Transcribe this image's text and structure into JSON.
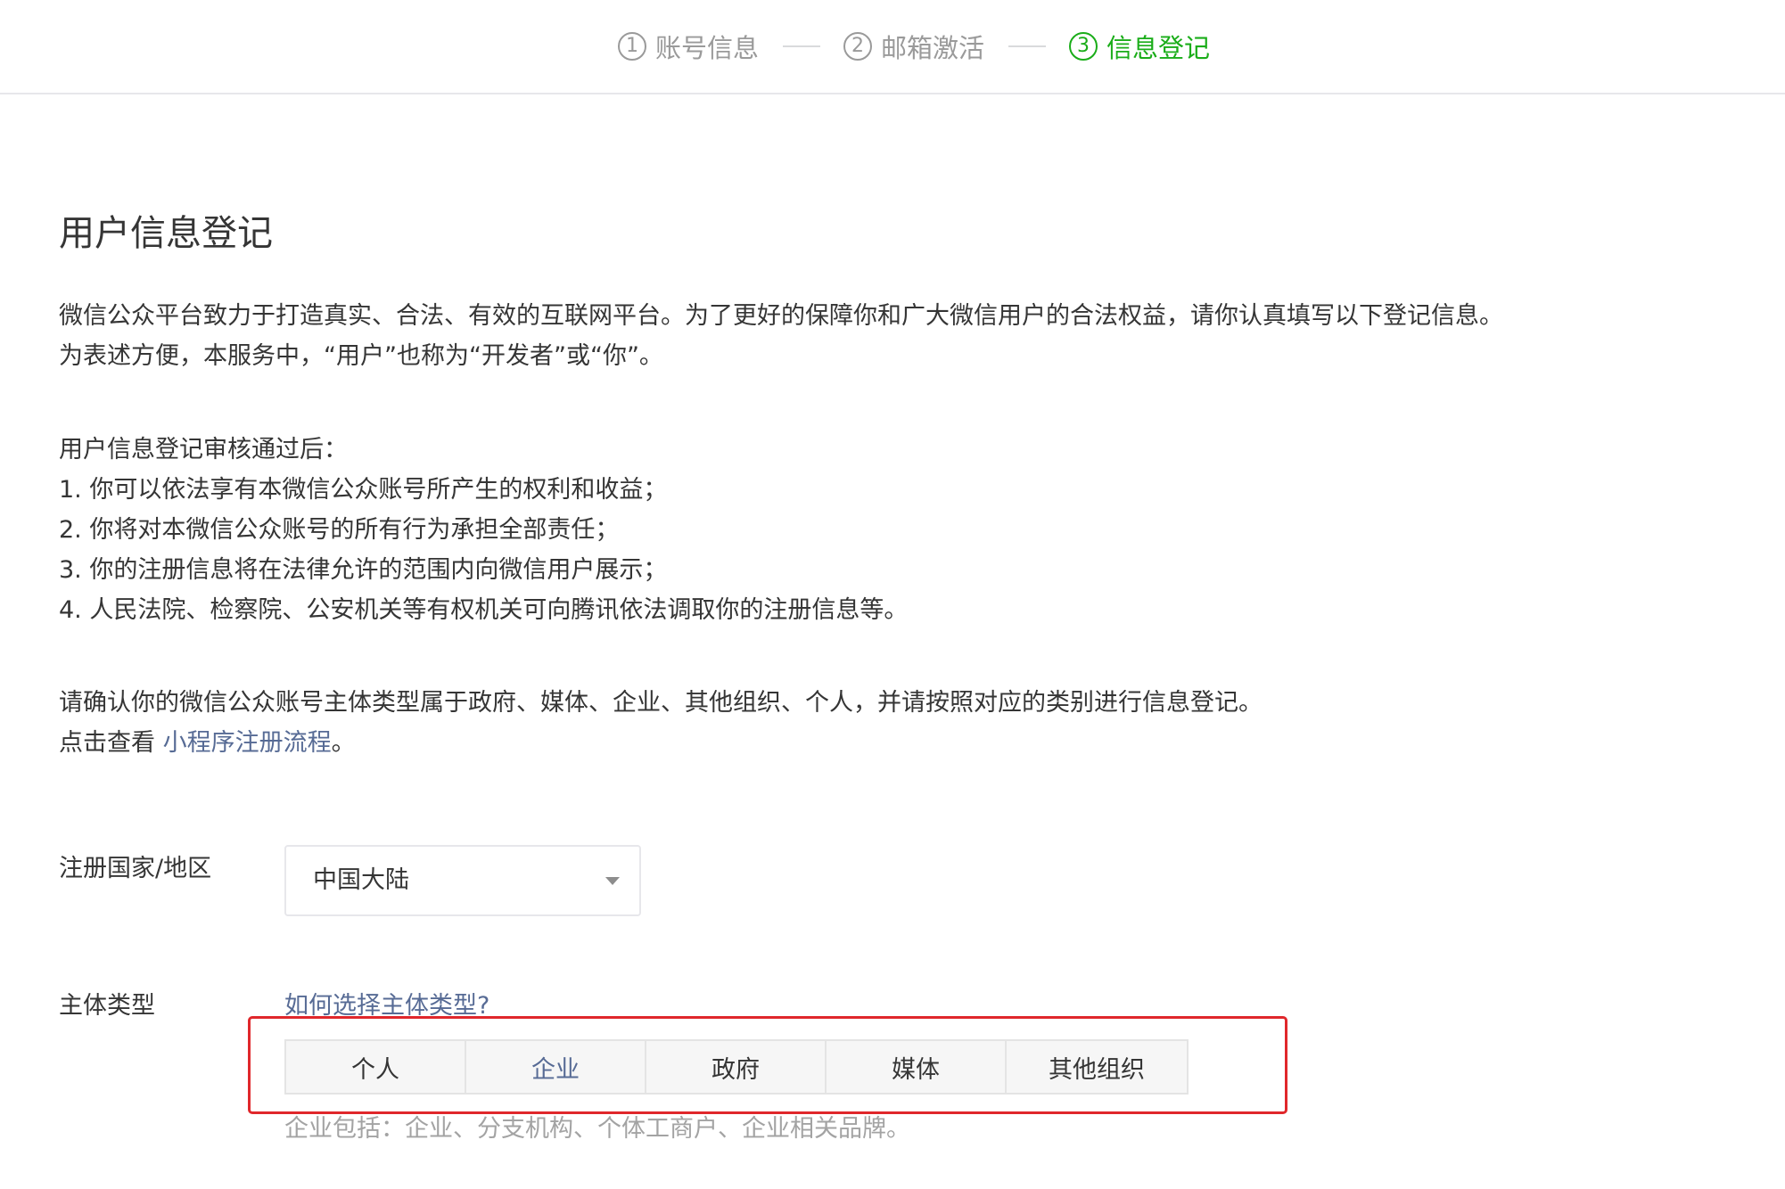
{
  "steps": [
    {
      "number": "1",
      "label": "账号信息"
    },
    {
      "number": "2",
      "label": "邮箱激活"
    },
    {
      "number": "3",
      "label": "信息登记"
    }
  ],
  "page": {
    "title": "用户信息登记",
    "intro_line1": "微信公众平台致力于打造真实、合法、有效的互联网平台。为了更好的保障你和广大微信用户的合法权益，请你认真填写以下登记信息。",
    "intro_line2": "为表述方便，本服务中，“用户”也称为“开发者”或“你”。",
    "after_title": "用户信息登记审核通过后：",
    "after_items": [
      "1. 你可以依法享有本微信公众账号所产生的权利和收益；",
      "2. 你将对本微信公众账号的所有行为承担全部责任；",
      "3. 你的注册信息将在法律允许的范围内向微信用户展示；",
      "4. 人民法院、检察院、公安机关等有权机关可向腾讯依法调取你的注册信息等。"
    ],
    "confirm_line": "请确认你的微信公众账号主体类型属于政府、媒体、企业、其他组织、个人，并请按照对应的类别进行信息登记。",
    "view_prefix": "点击查看 ",
    "view_link": "小程序注册流程",
    "view_suffix": "。"
  },
  "form": {
    "country_label": "注册国家/地区",
    "country_value": "中国大陆",
    "type_label": "主体类型",
    "type_help_link": "如何选择主体类型?",
    "type_options": [
      "个人",
      "企业",
      "政府",
      "媒体",
      "其他组织"
    ],
    "type_selected": "企业",
    "type_note": "企业包括：企业、分支机构、个体工商户、企业相关品牌。"
  },
  "colors": {
    "active_step": "#1aad19",
    "link": "#576b95",
    "highlight": "#e0272b"
  },
  "icons": {
    "select_caret": "caret-down-icon"
  }
}
